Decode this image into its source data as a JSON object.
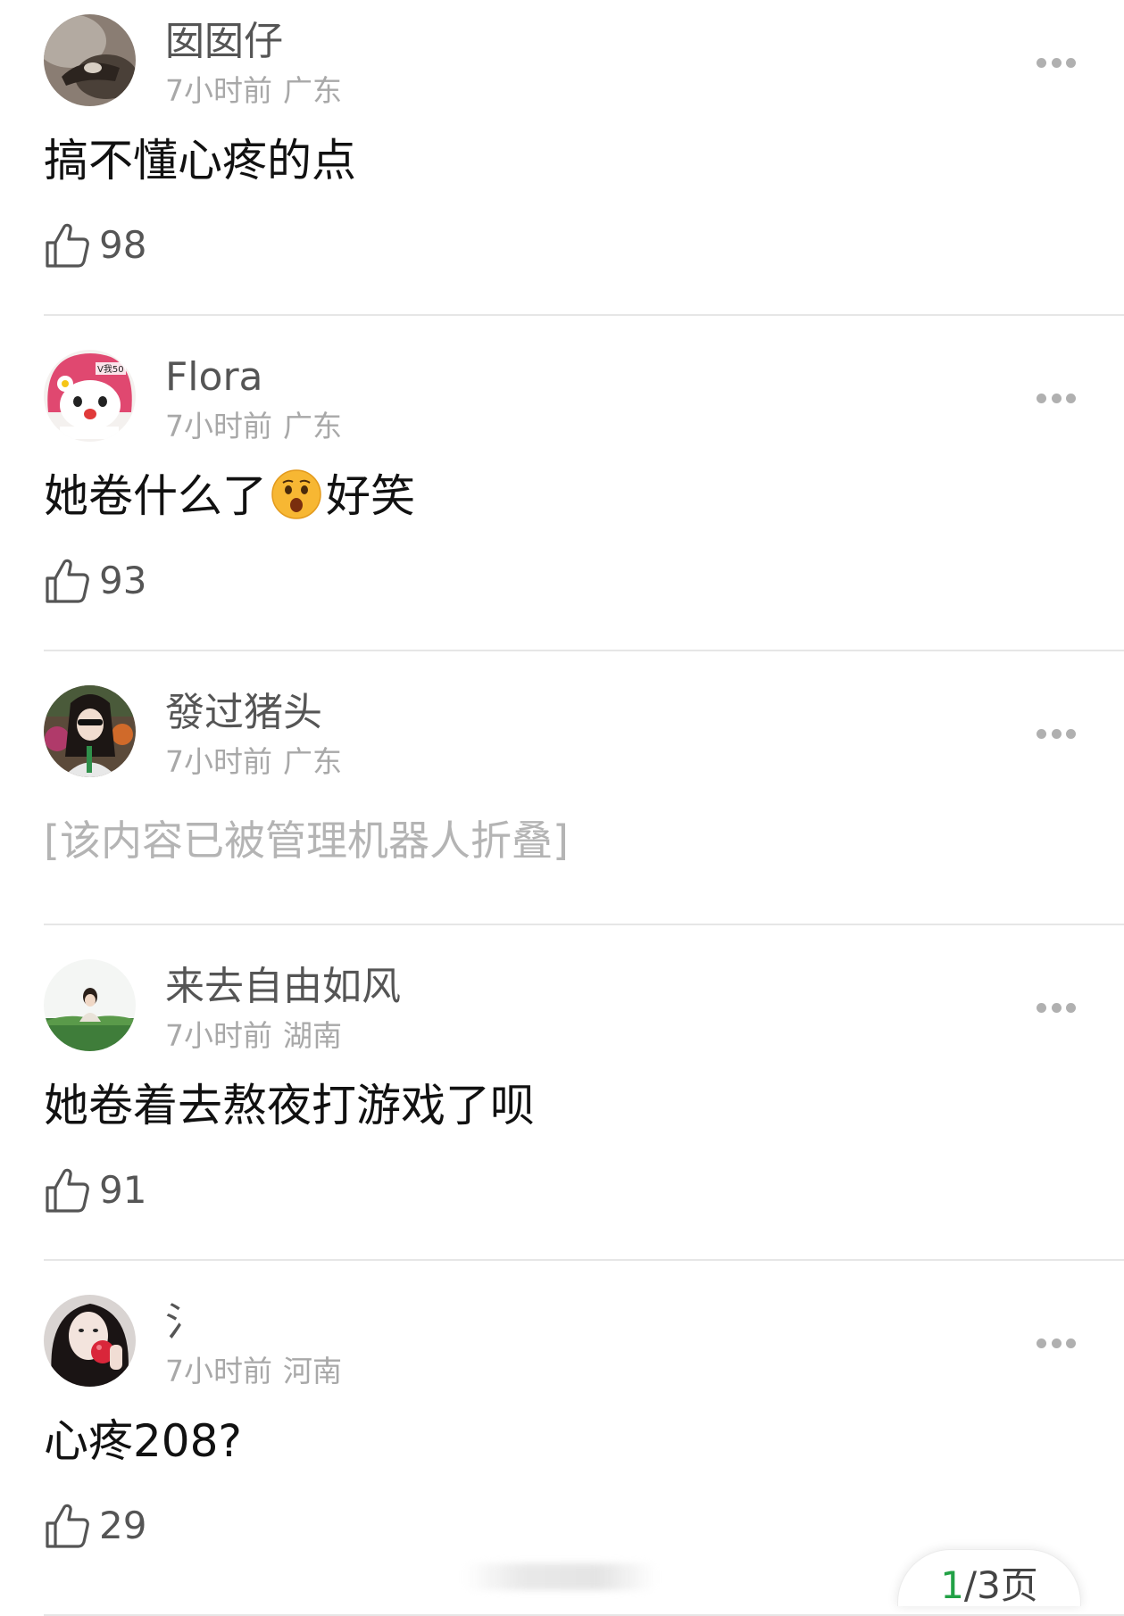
{
  "comments": [
    {
      "username": "囡囡仔",
      "time": "7小时前",
      "location": "广东",
      "text": "搞不懂心疼的点",
      "likes": "98",
      "avatar_icon": "avatar-photo-dark-icon"
    },
    {
      "username": "Flora",
      "time": "7小时前",
      "location": "广东",
      "text_before": "她卷什么了",
      "emoji": "shocked-face-emoji",
      "text_after": "好笑",
      "likes": "93",
      "avatar_icon": "avatar-my-melody-icon",
      "avatar_badge": "V我50"
    },
    {
      "username": "發过猪头",
      "time": "7小时前",
      "location": "广东",
      "text": "[该内容已被管理机器人折叠]",
      "folded": true,
      "avatar_icon": "avatar-portrait-girl-icon"
    },
    {
      "username": "来去自由如风",
      "time": "7小时前",
      "location": "湖南",
      "text": "她卷着去熬夜打游戏了呗",
      "likes": "91",
      "avatar_icon": "avatar-grass-girl-icon"
    },
    {
      "username": "氵",
      "time": "7小时前",
      "location": "河南",
      "text": "心疼208?",
      "likes": "29",
      "avatar_icon": "avatar-apple-girl-icon"
    }
  ],
  "pager": {
    "current": "1",
    "rest": "/3页"
  },
  "colors": {
    "accent_green": "#22a146",
    "meta_gray": "#a8a8a8",
    "divider": "#e6e6e6"
  }
}
